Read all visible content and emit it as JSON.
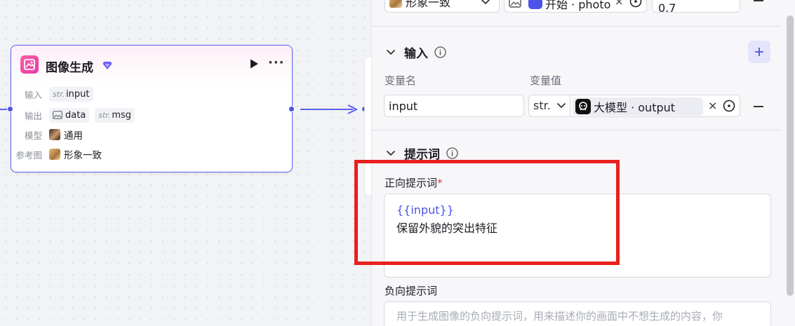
{
  "node": {
    "title": "图像生成",
    "input_label": "输入",
    "input_tag_type": "str.",
    "input_tag_name": "input",
    "output_label": "输出",
    "output_tag1_name": "data",
    "output_tag2_type": "str.",
    "output_tag2_name": "msg",
    "model_label": "模型",
    "model_value": "通用",
    "ref_label": "参考图",
    "ref_value": "形象一致"
  },
  "panel": {
    "top_row": {
      "ref_select": "形象一致",
      "chip_text": "开始 · photo",
      "strength_value": "0.7"
    },
    "input_section": {
      "title": "输入",
      "col_name": "变量名",
      "col_value": "变量值",
      "var_name": "input",
      "type_select": "str.",
      "ref_chip_text": "大模型 · output"
    },
    "prompt_section": {
      "title": "提示词",
      "positive_label": "正向提示词",
      "required_mark": "*",
      "positive_var": "{{input}}",
      "positive_text": "保留外貌的突出特征",
      "negative_label": "负向提示词",
      "negative_placeholder": "用于生成图像的负向提示词，用来描述你的画面中不想生成的内容，你"
    }
  },
  "colors": {
    "accent": "#4d53e8",
    "highlight": "#e8201e",
    "node_border": "#5b5ff0"
  }
}
